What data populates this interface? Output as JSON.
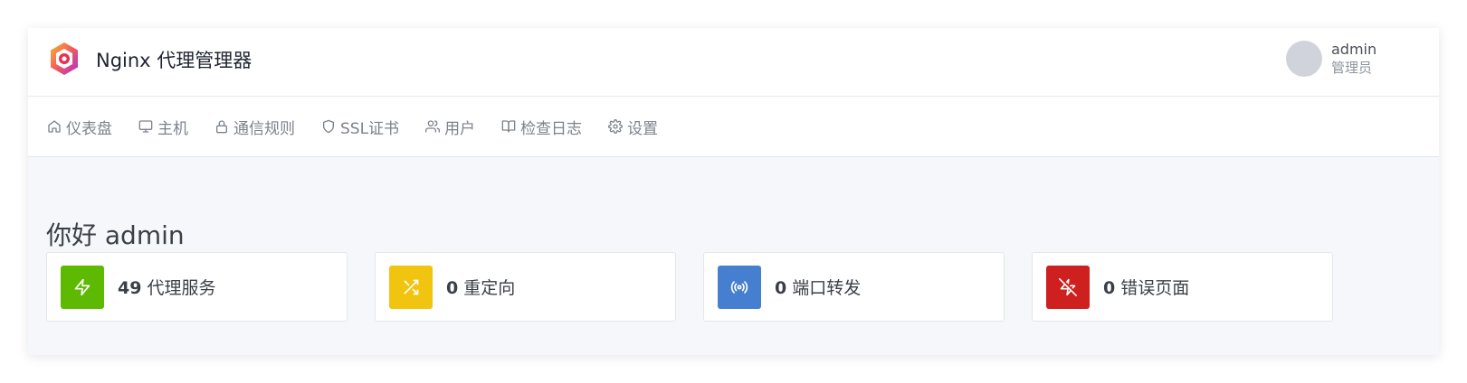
{
  "header": {
    "title": "Nginx 代理管理器",
    "logo_icon": "nginx-proxy-manager-logo"
  },
  "user": {
    "name": "admin",
    "role": "管理员"
  },
  "nav": {
    "items": [
      {
        "label": "仪表盘",
        "icon": "home-icon"
      },
      {
        "label": "主机",
        "icon": "monitor-icon"
      },
      {
        "label": "通信规则",
        "icon": "lock-icon"
      },
      {
        "label": "SSL证书",
        "icon": "shield-icon"
      },
      {
        "label": "用户",
        "icon": "users-icon"
      },
      {
        "label": "检查日志",
        "icon": "book-open-icon"
      },
      {
        "label": "设置",
        "icon": "gear-icon"
      }
    ]
  },
  "main": {
    "greeting": "你好 admin",
    "cards": [
      {
        "count": "49",
        "label": "代理服务",
        "icon": "zap-icon",
        "color": "#5eba00"
      },
      {
        "count": "0",
        "label": "重定向",
        "icon": "shuffle-icon",
        "color": "#f1c40f"
      },
      {
        "count": "0",
        "label": "端口转发",
        "icon": "radio-icon",
        "color": "#467fcf"
      },
      {
        "count": "0",
        "label": "错误页面",
        "icon": "zap-off-icon",
        "color": "#cd201f"
      }
    ]
  }
}
